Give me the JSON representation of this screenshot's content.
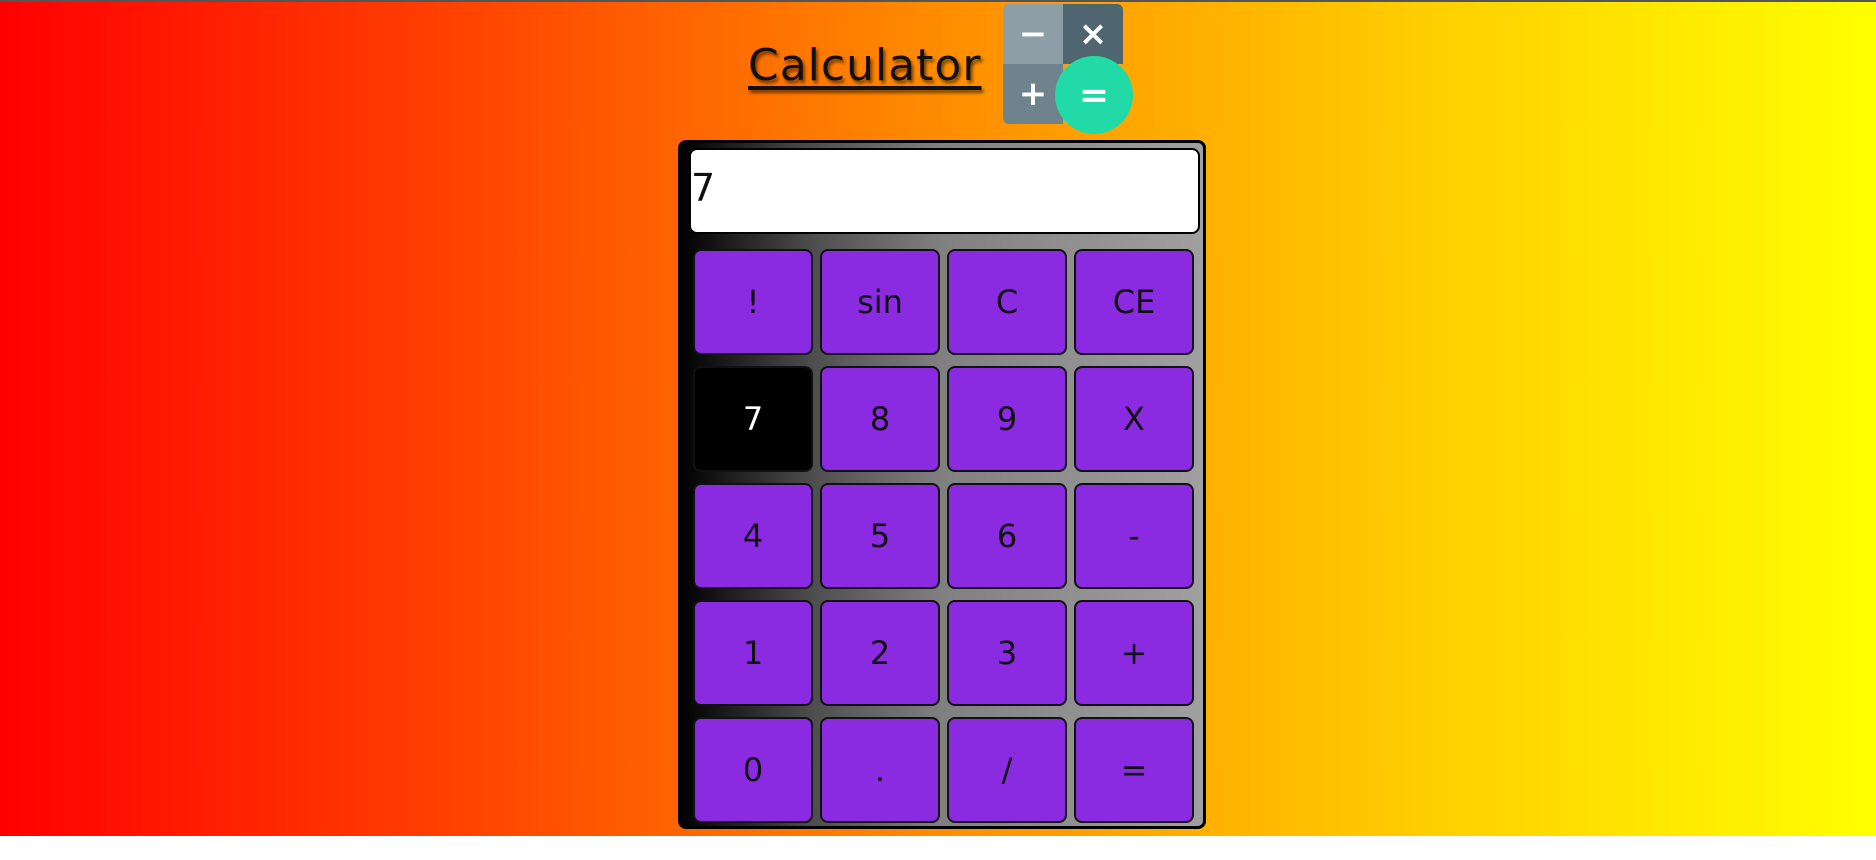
{
  "app": {
    "title": "Calculator"
  },
  "logo": {
    "top_left": "−",
    "top_right": "×",
    "bottom_left": "+",
    "bottom_right": "="
  },
  "display": {
    "value": "7"
  },
  "keys": {
    "row1": [
      "!",
      "sin",
      "C",
      "CE"
    ],
    "row2": [
      "7",
      "8",
      "9",
      "X"
    ],
    "row3": [
      "4",
      "5",
      "6",
      "-"
    ],
    "row4": [
      "1",
      "2",
      "3",
      "+"
    ],
    "row5": [
      "0",
      ".",
      "/",
      "="
    ]
  },
  "colors": {
    "key_background": "#8a2be2",
    "key_active_background": "#000000",
    "logo_equals": "#22d9a8",
    "gradient_start": "#ff0000",
    "gradient_end": "#ffff00"
  }
}
